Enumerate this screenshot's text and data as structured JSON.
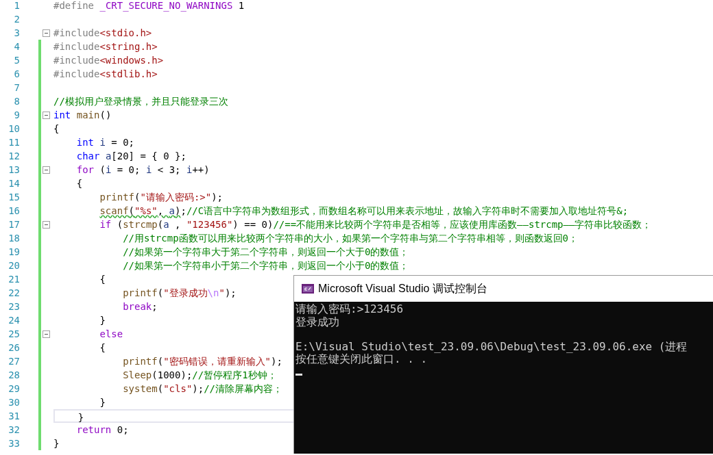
{
  "editor": {
    "lines": [
      {
        "number": "1",
        "changed": false,
        "current": false,
        "fold": false,
        "tokens": [
          {
            "kind": "pre",
            "text": "#define"
          },
          {
            "kind": "macro",
            "text": " _CRT_SECURE_NO_WARNINGS"
          },
          {
            "kind": "plain",
            "text": " 1"
          }
        ]
      },
      {
        "number": "2",
        "changed": false,
        "current": false,
        "fold": false
      },
      {
        "number": "3",
        "changed": false,
        "current": false,
        "fold": true,
        "tokens": [
          {
            "kind": "pre",
            "text": "#include"
          },
          {
            "kind": "inc",
            "text": "<stdio.h>"
          }
        ]
      },
      {
        "number": "4",
        "changed": true,
        "current": false,
        "fold": false,
        "tokens": [
          {
            "kind": "pre",
            "text": "#include"
          },
          {
            "kind": "inc",
            "text": "<string.h>"
          }
        ]
      },
      {
        "number": "5",
        "changed": true,
        "current": false,
        "fold": false,
        "tokens": [
          {
            "kind": "pre",
            "text": "#include"
          },
          {
            "kind": "inc",
            "text": "<windows.h>"
          }
        ]
      },
      {
        "number": "6",
        "changed": true,
        "current": false,
        "fold": false,
        "tokens": [
          {
            "kind": "pre",
            "text": "#include"
          },
          {
            "kind": "inc",
            "text": "<stdlib.h>"
          }
        ]
      },
      {
        "number": "7",
        "changed": true,
        "current": false,
        "fold": false
      },
      {
        "number": "8",
        "changed": true,
        "current": false,
        "fold": false,
        "tokens": [
          {
            "kind": "cmt",
            "text": "//模拟用户登录情景，并且只能登录三次"
          }
        ]
      },
      {
        "number": "9",
        "changed": true,
        "current": false,
        "fold": true,
        "tokens": [
          {
            "kind": "kw",
            "text": "int"
          },
          {
            "kind": "fn",
            "text": " main"
          },
          {
            "kind": "plain",
            "text": "()"
          }
        ]
      },
      {
        "number": "10",
        "changed": true,
        "current": false,
        "fold": false,
        "tokens": [
          {
            "kind": "plain",
            "text": "{"
          }
        ]
      },
      {
        "number": "11",
        "changed": true,
        "current": false,
        "fold": false,
        "tokens": [
          {
            "kind": "kw",
            "text": "    int"
          },
          {
            "kind": "var",
            "text": " i"
          },
          {
            "kind": "plain",
            "text": " = 0;"
          }
        ]
      },
      {
        "number": "12",
        "changed": true,
        "current": false,
        "fold": false,
        "tokens": [
          {
            "kind": "kw",
            "text": "    char"
          },
          {
            "kind": "var",
            "text": " a"
          },
          {
            "kind": "plain",
            "text": "[20] = { 0 };"
          }
        ]
      },
      {
        "number": "13",
        "changed": true,
        "current": false,
        "fold": true,
        "tokens": [
          {
            "kind": "ctrl",
            "text": "    for"
          },
          {
            "kind": "plain",
            "text": " ("
          },
          {
            "kind": "var",
            "text": "i"
          },
          {
            "kind": "plain",
            "text": " = 0; "
          },
          {
            "kind": "var",
            "text": "i"
          },
          {
            "kind": "plain",
            "text": " < 3; "
          },
          {
            "kind": "var",
            "text": "i"
          },
          {
            "kind": "plain",
            "text": "++)"
          }
        ]
      },
      {
        "number": "14",
        "changed": true,
        "current": false,
        "fold": false,
        "tokens": [
          {
            "kind": "plain",
            "text": "    {"
          }
        ]
      },
      {
        "number": "15",
        "changed": true,
        "current": false,
        "fold": false,
        "tokens": [
          {
            "kind": "fn",
            "text": "        printf"
          },
          {
            "kind": "plain",
            "text": "("
          },
          {
            "kind": "str",
            "text": "\"请输入密码:>\""
          },
          {
            "kind": "plain",
            "text": ");"
          }
        ]
      },
      {
        "number": "16",
        "changed": true,
        "current": false,
        "fold": false,
        "tokens": [
          {
            "kind": "fn",
            "text": "        scanf",
            "squiggle": true
          },
          {
            "kind": "plain",
            "text": "(",
            "squiggle": true
          },
          {
            "kind": "str",
            "text": "\"%s\"",
            "squiggle": true
          },
          {
            "kind": "plain",
            "text": ", ",
            "squiggle": true
          },
          {
            "kind": "var",
            "text": "a",
            "squiggle": true
          },
          {
            "kind": "plain",
            "text": ")",
            "squiggle": true
          },
          {
            "kind": "plain",
            "text": ";",
            "squiggle": false
          },
          {
            "kind": "cmt",
            "text": "//C语言中字符串为数组形式，而数组名称可以用来表示地址，故输入字符串时不需要加入取地址符号&;",
            "squiggle": false
          }
        ]
      },
      {
        "number": "17",
        "changed": true,
        "current": false,
        "fold": true,
        "tokens": [
          {
            "kind": "ctrl",
            "text": "        if"
          },
          {
            "kind": "plain",
            "text": " ("
          },
          {
            "kind": "fn",
            "text": "strcmp"
          },
          {
            "kind": "plain",
            "text": "("
          },
          {
            "kind": "var",
            "text": "a"
          },
          {
            "kind": "plain",
            "text": " , "
          },
          {
            "kind": "str",
            "text": "\"123456\""
          },
          {
            "kind": "plain",
            "text": ") == 0)"
          },
          {
            "kind": "cmt",
            "text": "//==不能用来比较两个字符串是否相等，应该使用库函数——strcmp——字符串比较函数；"
          }
        ]
      },
      {
        "number": "18",
        "changed": true,
        "current": false,
        "fold": false,
        "tokens": [
          {
            "kind": "cmt",
            "text": "            //用strcmp函数可以用来比较两个字符串的大小，如果第一个字符串与第二个字符串相等，则函数返回0；"
          }
        ]
      },
      {
        "number": "19",
        "changed": true,
        "current": false,
        "fold": false,
        "tokens": [
          {
            "kind": "cmt",
            "text": "            //如果第一个字符串大于第二个字符串，则返回一个大于0的数值；"
          }
        ]
      },
      {
        "number": "20",
        "changed": true,
        "current": false,
        "fold": false,
        "tokens": [
          {
            "kind": "cmt",
            "text": "            //如果第一个字符串小于第二个字符串，则返回一个小于0的数值；"
          }
        ]
      },
      {
        "number": "21",
        "changed": true,
        "current": false,
        "fold": false,
        "tokens": [
          {
            "kind": "plain",
            "text": "        {"
          }
        ]
      },
      {
        "number": "22",
        "changed": true,
        "current": false,
        "fold": false,
        "tokens": [
          {
            "kind": "fn",
            "text": "            printf"
          },
          {
            "kind": "plain",
            "text": "("
          },
          {
            "kind": "str",
            "text": "\"登录成功"
          },
          {
            "kind": "esc",
            "text": "\\n"
          },
          {
            "kind": "str",
            "text": "\""
          },
          {
            "kind": "plain",
            "text": ");"
          }
        ]
      },
      {
        "number": "23",
        "changed": true,
        "current": false,
        "fold": false,
        "tokens": [
          {
            "kind": "ctrl",
            "text": "            break"
          },
          {
            "kind": "plain",
            "text": ";"
          }
        ]
      },
      {
        "number": "24",
        "changed": true,
        "current": false,
        "fold": false,
        "tokens": [
          {
            "kind": "plain",
            "text": "        }"
          }
        ]
      },
      {
        "number": "25",
        "changed": true,
        "current": false,
        "fold": true,
        "tokens": [
          {
            "kind": "ctrl",
            "text": "        else"
          }
        ]
      },
      {
        "number": "26",
        "changed": true,
        "current": false,
        "fold": false,
        "tokens": [
          {
            "kind": "plain",
            "text": "        {"
          }
        ]
      },
      {
        "number": "27",
        "changed": true,
        "current": false,
        "fold": false,
        "tokens": [
          {
            "kind": "fn",
            "text": "            printf"
          },
          {
            "kind": "plain",
            "text": "("
          },
          {
            "kind": "str",
            "text": "\"密码错误，请重新输入\""
          },
          {
            "kind": "plain",
            "text": ");"
          }
        ]
      },
      {
        "number": "28",
        "changed": true,
        "current": false,
        "fold": false,
        "tokens": [
          {
            "kind": "fn",
            "text": "            Sleep"
          },
          {
            "kind": "plain",
            "text": "(1000);"
          },
          {
            "kind": "cmt",
            "text": "//暂停程序1秒钟；"
          }
        ]
      },
      {
        "number": "29",
        "changed": true,
        "current": false,
        "fold": false,
        "tokens": [
          {
            "kind": "fn",
            "text": "            system"
          },
          {
            "kind": "plain",
            "text": "("
          },
          {
            "kind": "str",
            "text": "\"cls\""
          },
          {
            "kind": "plain",
            "text": ");"
          },
          {
            "kind": "cmt",
            "text": "//清除屏幕内容；"
          }
        ]
      },
      {
        "number": "30",
        "changed": true,
        "current": false,
        "fold": false,
        "tokens": [
          {
            "kind": "plain",
            "text": "        }"
          }
        ]
      },
      {
        "number": "31",
        "changed": true,
        "current": true,
        "fold": false,
        "tokens": [
          {
            "kind": "plain",
            "text": "    }"
          }
        ]
      },
      {
        "number": "32",
        "changed": true,
        "current": false,
        "fold": false,
        "tokens": [
          {
            "kind": "ctrl",
            "text": "    return"
          },
          {
            "kind": "plain",
            "text": " 0;"
          }
        ]
      },
      {
        "number": "33",
        "changed": true,
        "current": false,
        "fold": false,
        "tokens": [
          {
            "kind": "plain",
            "text": "}"
          }
        ]
      }
    ]
  },
  "console": {
    "title": "Microsoft Visual Studio 调试控制台",
    "lines": [
      {
        "text": "请输入密码:>123456",
        "gap_before": false
      },
      {
        "text": "登录成功",
        "gap_before": false
      },
      {
        "text": "E:\\Visual Studio\\test_23.09.06\\Debug\\test_23.09.06.exe (进程",
        "gap_before": true
      },
      {
        "text": "按任意键关闭此窗口. . .",
        "gap_before": false
      }
    ],
    "cursor": true
  }
}
